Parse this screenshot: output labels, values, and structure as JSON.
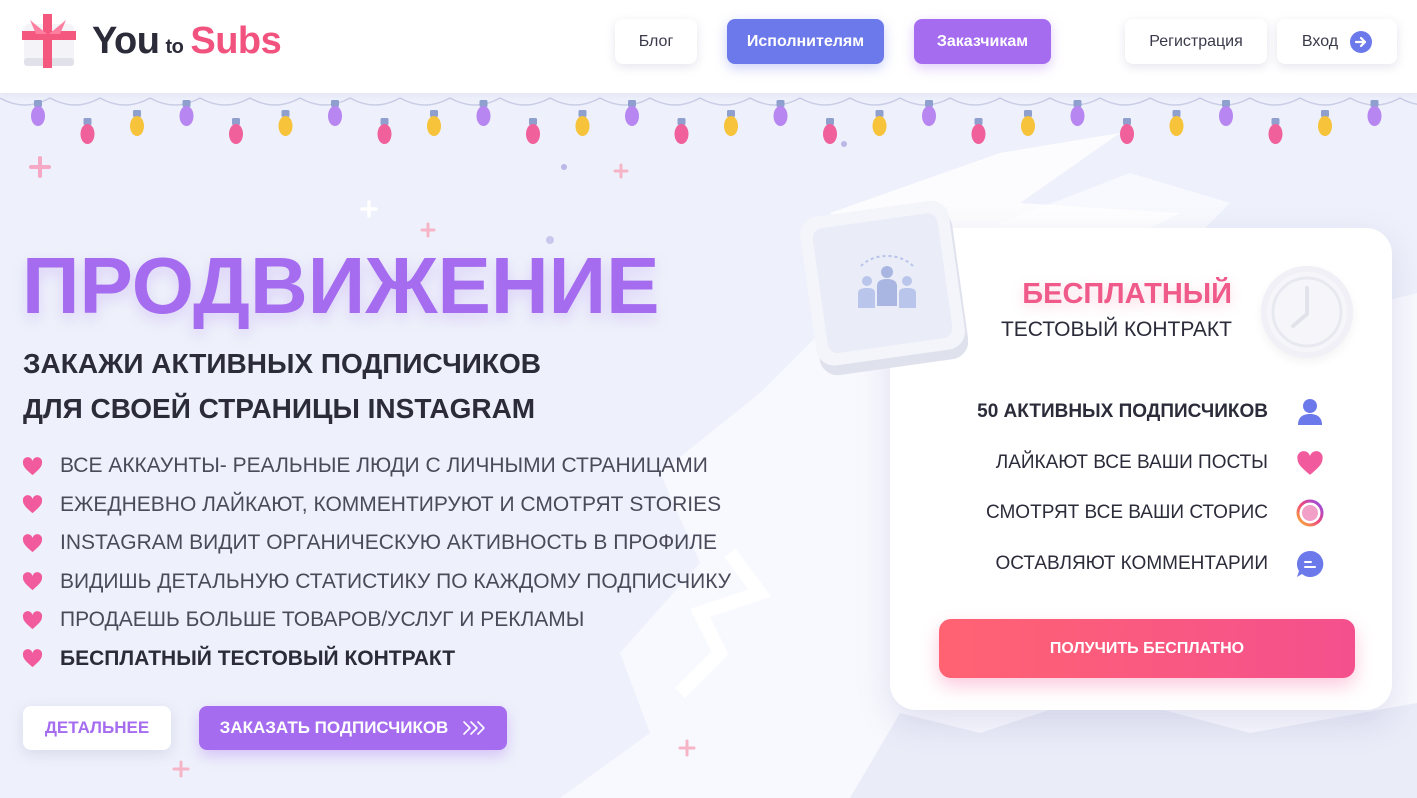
{
  "logo": {
    "you": "You",
    "to": "to",
    "subs": "Subs"
  },
  "nav": {
    "blog": "Блог",
    "performers": "Исполнителям",
    "customers": "Заказчикам",
    "register": "Регистрация",
    "login": "Вход"
  },
  "hero": {
    "title": "ПРОДВИЖЕНИЕ",
    "subtitle_line1": "ЗАКАЖИ АКТИВНЫХ ПОДПИСЧИКОВ",
    "subtitle_line2": "ДЛЯ СВОЕЙ СТРАНИЦЫ INSTAGRAM",
    "features": [
      "ВСЕ АККАУНТЫ- РЕАЛЬНЫЕ ЛЮДИ С ЛИЧНЫМИ СТРАНИЦАМИ",
      "ЕЖЕДНЕВНО ЛАЙКАЮТ, КОММЕНТИРУЮТ И СМОТРЯТ STORIES",
      "INSTAGRAM ВИДИТ ОРГАНИЧЕСКУЮ АКТИВНОСТЬ В ПРОФИЛЕ",
      "ВИДИШЬ ДЕТАЛЬНУЮ СТАТИСТИКУ ПО КАЖДОМУ ПОДПИСЧИКУ",
      "ПРОДАЕШЬ БОЛЬШЕ ТОВАРОВ/УСЛУГ И РЕКЛАМЫ",
      "БЕСПЛАТНЫЙ ТЕСТОВЫЙ КОНТРАКТ"
    ],
    "details_button": "ДЕТАЛЬНЕЕ",
    "order_button": "ЗАКАЗАТЬ ПОДПИСЧИКОВ"
  },
  "card": {
    "title_accent": "БЕСПЛАТНЫЙ",
    "title_rest": "ТЕСТОВЫЙ КОНТРАКТ",
    "rows": [
      {
        "label": "50 АКТИВНЫХ ПОДПИСЧИКОВ",
        "icon": "user-icon"
      },
      {
        "label": "ЛАЙКАЮТ ВСЕ ВАШИ ПОСТЫ",
        "icon": "heart-icon"
      },
      {
        "label": "СМОТРЯТ ВСЕ ВАШИ СТОРИС",
        "icon": "stories-ring-icon"
      },
      {
        "label": "ОСТАВЛЯЮТ КОММЕНТАРИИ",
        "icon": "comment-icon"
      }
    ],
    "cta": "ПОЛУЧИТЬ БЕСПЛАТНО"
  },
  "colors": {
    "purple": "#a56cf0",
    "blue": "#6c79ea",
    "pink": "#f05a8a",
    "heart": "#f15b9d"
  }
}
